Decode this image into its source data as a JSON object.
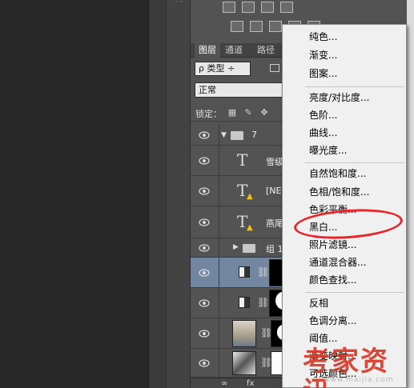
{
  "panel": {
    "tabs": [
      {
        "label": "图层",
        "active": true
      },
      {
        "label": "通道",
        "active": false
      },
      {
        "label": "路径",
        "active": false
      }
    ],
    "filter": {
      "selected": "ρ 类型 ÷"
    },
    "blend": {
      "selected": "正常"
    },
    "lock_label": "锁定："
  },
  "layers": [
    {
      "type": "group",
      "name": "7",
      "expanded": true
    },
    {
      "type": "text",
      "name": "雪级"
    },
    {
      "type": "text-warning",
      "name": "[NEV"
    },
    {
      "type": "text-warning",
      "name": "燕尾"
    },
    {
      "type": "group",
      "name": "组 1",
      "expanded": false
    },
    {
      "type": "adjustment",
      "name": "",
      "selected": true
    },
    {
      "type": "adjustment",
      "name": ""
    },
    {
      "type": "image",
      "name": ""
    },
    {
      "type": "image",
      "name": ""
    }
  ],
  "bottom_bar": {
    "link": "∞",
    "fx": "fx"
  },
  "menu": {
    "items": [
      {
        "label": "纯色..."
      },
      {
        "label": "渐变..."
      },
      {
        "label": "图案..."
      },
      {
        "sep": true
      },
      {
        "label": "亮度/对比度..."
      },
      {
        "label": "色阶..."
      },
      {
        "label": "曲线..."
      },
      {
        "label": "曝光度..."
      },
      {
        "sep": true
      },
      {
        "label": "自然饱和度..."
      },
      {
        "label": "色相/饱和度..."
      },
      {
        "label": "色彩平衡..."
      },
      {
        "label": "黑白...",
        "highlighted": true
      },
      {
        "label": "照片滤镜..."
      },
      {
        "label": "通道混合器..."
      },
      {
        "label": "颜色查找..."
      },
      {
        "sep": true
      },
      {
        "label": "反相"
      },
      {
        "label": "色调分离..."
      },
      {
        "label": "阈值..."
      },
      {
        "label": "渐变映射..."
      },
      {
        "label": "可选颜色..."
      }
    ]
  },
  "watermark": {
    "text": "考家资讯",
    "url": "www.maijia.com"
  },
  "colors": {
    "highlight_ring": "#e8262a",
    "selected_layer": "#7286a0",
    "panel_bg": "#535353",
    "menu_bg": "#f0f0f0",
    "watermark": "#d63828"
  }
}
